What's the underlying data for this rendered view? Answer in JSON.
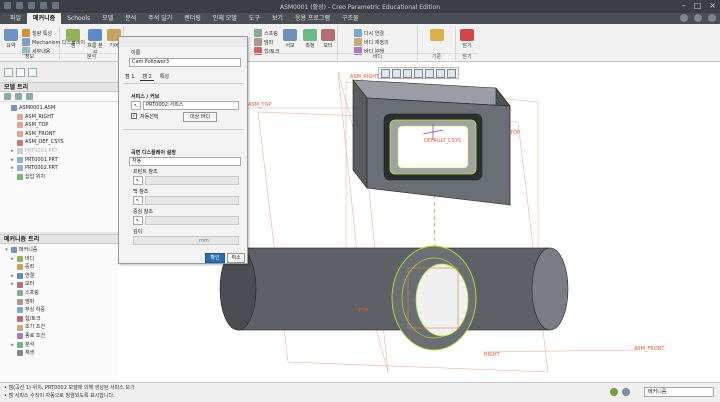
{
  "window": {
    "title": "ASM0001 (활성) - Creo Parametric Educational Edition"
  },
  "menu": {
    "tabs": [
      {
        "label": "파일",
        "active": false
      },
      {
        "label": "메커니즘",
        "active": true
      },
      {
        "label": "Schools",
        "active": false
      },
      {
        "label": "모델",
        "active": false
      },
      {
        "label": "분석",
        "active": false
      },
      {
        "label": "주석 달기",
        "active": false
      },
      {
        "label": "렌더링",
        "active": false
      },
      {
        "label": "인체 모델",
        "active": false
      },
      {
        "label": "도구",
        "active": false
      },
      {
        "label": "보기",
        "active": false
      },
      {
        "label": "응용 프로그램",
        "active": false
      },
      {
        "label": "구조물",
        "active": false
      }
    ]
  },
  "ribbon": {
    "summary": "요약",
    "playback": "질량 특성",
    "mechanism_display": "Mechanism 디스플레이",
    "detail": "세부내용",
    "info_group": "정보",
    "analysis_group": "분석",
    "connect": "캠",
    "unit": "흐름 분석",
    "gears": "기어",
    "spring": "스프링",
    "damper": "댐퍼",
    "force": "힘/토크",
    "servo": "서보",
    "measure": "측정",
    "motor": "모터",
    "feature_group": "특성 및 조건",
    "body_group": "바디",
    "ground": "다시 연결",
    "body_redefine": "바디 재정의",
    "body_explode": "바디 분해",
    "base_group": "기준",
    "close": "닫기",
    "close_group": "닫기"
  },
  "model_tree": {
    "heading": "모델 트리",
    "items": [
      {
        "label": "ASM0001.ASM",
        "dim": false,
        "expand": ""
      },
      {
        "label": "ASM_RIGHT",
        "dim": false,
        "expand": ""
      },
      {
        "label": "ASM_TOP",
        "dim": false,
        "expand": ""
      },
      {
        "label": "ASM_FRONT",
        "dim": false,
        "expand": ""
      },
      {
        "label": "ASM_DEF_CSYS",
        "dim": false,
        "expand": ""
      },
      {
        "label": "PRT0001.PRT",
        "dim": true,
        "expand": "▸"
      },
      {
        "label": "PRT0001.PRT",
        "dim": false,
        "expand": "▸"
      },
      {
        "label": "PRT0002.PRT",
        "dim": false,
        "expand": "▸"
      },
      {
        "label": "삽입 위치",
        "dim": false,
        "expand": ""
      }
    ]
  },
  "mech_tree": {
    "heading": "메커니즘 트리",
    "items": [
      {
        "label": "메커니즘",
        "expand": "▾"
      },
      {
        "label": "바디",
        "expand": "▸"
      },
      {
        "label": "중력",
        "expand": ""
      },
      {
        "label": "연결",
        "expand": "▸"
      },
      {
        "label": "모터",
        "expand": "▸"
      },
      {
        "label": "스프링",
        "expand": ""
      },
      {
        "label": "댐퍼",
        "expand": ""
      },
      {
        "label": "부싱 하중",
        "expand": ""
      },
      {
        "label": "힘/토크",
        "expand": ""
      },
      {
        "label": "초기 조건",
        "expand": ""
      },
      {
        "label": "종료 조건",
        "expand": ""
      },
      {
        "label": "분석",
        "expand": "▸"
      },
      {
        "label": "재생",
        "expand": ""
      }
    ]
  },
  "dialog": {
    "name_label": "이름",
    "name_value": "Cam Follower3",
    "tabs": [
      {
        "label": "캠 1",
        "active": false
      },
      {
        "label": "캠 2",
        "active": true
      },
      {
        "label": "특성",
        "active": false
      }
    ],
    "surface_section": "서피스 / 커브",
    "surface_value": "PRT0002:서피스",
    "auto_select_label": "자동선택",
    "select_body_btn": "대상 바디",
    "display_section": "곡면 디스플레이 설정",
    "display_value": "자동",
    "front_ref_label": "프런트 참조",
    "back_ref_label": "백 참조",
    "center_ref_label": "중심 참조",
    "depth_label": "깊이",
    "depth_unit": "mm",
    "ok_label": "확인",
    "cancel_label": "취소"
  },
  "viewport": {
    "labels": [
      "ASM_TOP",
      "ASM_RIGHT",
      "TOP",
      "DEFAULT_CSYS",
      "RIGHT",
      "ASM_FRONT",
      "TOP"
    ]
  },
  "status": {
    "line1": "• 캠(곡선 1) 위치, PRT0002 모델에 의해 생성된 서피스 보기",
    "line2": "• 캠 서피스 수직이 자동으로 정렬되도록 표시합니다.",
    "filter_value": "메커니즘"
  },
  "colors": {
    "accent": "#2a6fb3",
    "titlebar": "#3b3f45",
    "model_gray": "#6a6e75",
    "highlight": "#b5e61d"
  }
}
